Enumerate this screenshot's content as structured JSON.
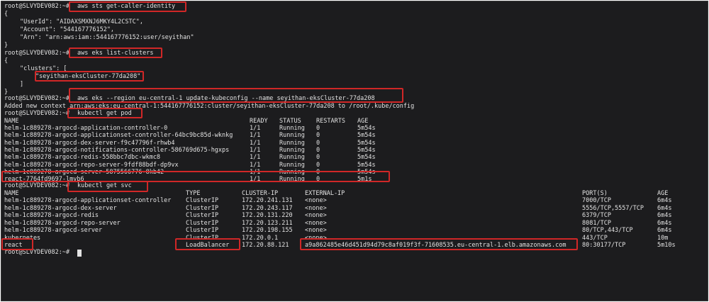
{
  "prompt": "root@SLVYDEV082:~#",
  "cmd1": "aws sts get-caller-identity",
  "identity": {
    "open": "{",
    "user_id_line": "\"UserId\": \"AIDAXSMXNJ6MKY4L2CSTC\",",
    "account_line": "\"Account\": \"544167776152\",",
    "arn_line": "\"Arn\": \"arn:aws:iam::544167776152:user/seyithan\"",
    "close": "}"
  },
  "cmd2": "aws eks list-clusters",
  "clusters": {
    "open": "{",
    "key_line": "\"clusters\": [",
    "name": "\"seyithan-eksCluster-77da208\"",
    "bracket": "]",
    "close": "}"
  },
  "cmd3": "aws eks --region eu-central-1 update-kubeconfig --name seyithan-eksCluster-77da208",
  "kubeconfig_msg": "Added new context arn:aws:eks:eu-central-1:544167776152:cluster/seyithan-eksCluster-77da208 to /root/.kube/config",
  "cmd4": "kubectl get pod",
  "pods": {
    "headers": [
      "NAME",
      "READY",
      "STATUS",
      "RESTARTS",
      "AGE"
    ],
    "rows": [
      [
        "helm-1c889278-argocd-application-controller-0",
        "1/1",
        "Running",
        "0",
        "5m54s"
      ],
      [
        "helm-1c889278-argocd-applicationset-controller-64bc9bc85d-wknkg",
        "1/1",
        "Running",
        "0",
        "5m54s"
      ],
      [
        "helm-1c889278-argocd-dex-server-f9c47796f-rhwb4",
        "1/1",
        "Running",
        "0",
        "5m54s"
      ],
      [
        "helm-1c889278-argocd-notifications-controller-586769d675-hgxps",
        "1/1",
        "Running",
        "0",
        "5m54s"
      ],
      [
        "helm-1c889278-argocd-redis-558bbc7dbc-wkmc8",
        "1/1",
        "Running",
        "0",
        "5m54s"
      ],
      [
        "helm-1c889278-argocd-repo-server-9fdf88bdf-dp9vx",
        "1/1",
        "Running",
        "0",
        "5m54s"
      ],
      [
        "helm-1c889278-argocd-server-5875566776-8kb42",
        "1/1",
        "Running",
        "0",
        "5m54s"
      ],
      [
        "react-7764fd9697-lmvb6",
        "1/1",
        "Running",
        "0",
        "5m1s"
      ]
    ]
  },
  "cmd5": "kubectl get svc",
  "svcs": {
    "headers": [
      "NAME",
      "TYPE",
      "CLUSTER-IP",
      "EXTERNAL-IP",
      "PORT(S)",
      "AGE"
    ],
    "rows": [
      [
        "helm-1c889278-argocd-applicationset-controller",
        "ClusterIP",
        "172.20.241.131",
        "<none>",
        "7000/TCP",
        "6m4s"
      ],
      [
        "helm-1c889278-argocd-dex-server",
        "ClusterIP",
        "172.20.243.117",
        "<none>",
        "5556/TCP,5557/TCP",
        "6m4s"
      ],
      [
        "helm-1c889278-argocd-redis",
        "ClusterIP",
        "172.20.131.220",
        "<none>",
        "6379/TCP",
        "6m4s"
      ],
      [
        "helm-1c889278-argocd-repo-server",
        "ClusterIP",
        "172.20.123.211",
        "<none>",
        "8081/TCP",
        "6m4s"
      ],
      [
        "helm-1c889278-argocd-server",
        "ClusterIP",
        "172.20.198.155",
        "<none>",
        "80/TCP,443/TCP",
        "6m4s"
      ],
      [
        "kubernetes",
        "ClusterIP",
        "172.20.0.1",
        "<none>",
        "443/TCP",
        "10m"
      ],
      [
        "react",
        "LoadBalancer",
        "172.20.88.121",
        "a9a862485e46d451d94d79c8af019f3f-71608535.eu-central-1.elb.amazonaws.com",
        "80:30177/TCP",
        "5m10s"
      ]
    ]
  },
  "highlight_color": "#d02727"
}
